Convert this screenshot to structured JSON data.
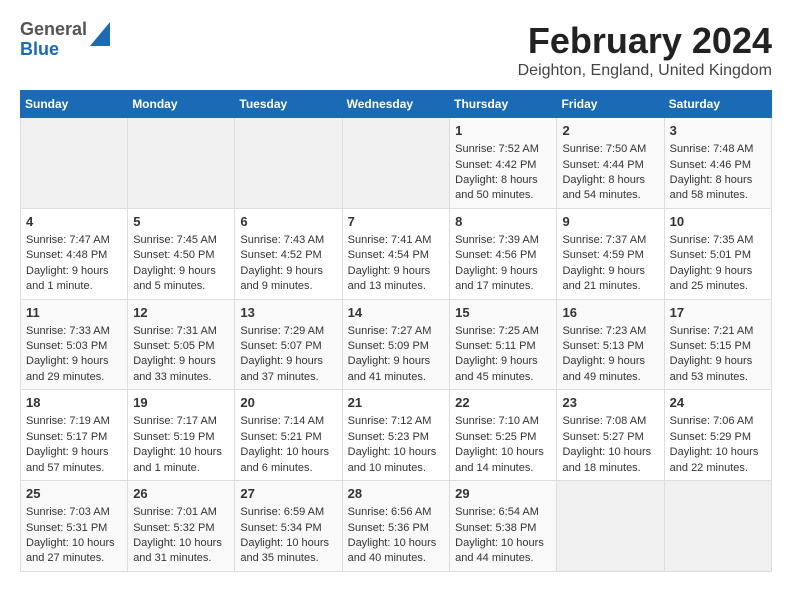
{
  "header": {
    "logo_general": "General",
    "logo_blue": "Blue",
    "title": "February 2024",
    "subtitle": "Deighton, England, United Kingdom"
  },
  "days_of_week": [
    "Sunday",
    "Monday",
    "Tuesday",
    "Wednesday",
    "Thursday",
    "Friday",
    "Saturday"
  ],
  "weeks": [
    [
      {
        "day": "",
        "content": ""
      },
      {
        "day": "",
        "content": ""
      },
      {
        "day": "",
        "content": ""
      },
      {
        "day": "",
        "content": ""
      },
      {
        "day": "1",
        "content": "Sunrise: 7:52 AM\nSunset: 4:42 PM\nDaylight: 8 hours\nand 50 minutes."
      },
      {
        "day": "2",
        "content": "Sunrise: 7:50 AM\nSunset: 4:44 PM\nDaylight: 8 hours\nand 54 minutes."
      },
      {
        "day": "3",
        "content": "Sunrise: 7:48 AM\nSunset: 4:46 PM\nDaylight: 8 hours\nand 58 minutes."
      }
    ],
    [
      {
        "day": "4",
        "content": "Sunrise: 7:47 AM\nSunset: 4:48 PM\nDaylight: 9 hours\nand 1 minute."
      },
      {
        "day": "5",
        "content": "Sunrise: 7:45 AM\nSunset: 4:50 PM\nDaylight: 9 hours\nand 5 minutes."
      },
      {
        "day": "6",
        "content": "Sunrise: 7:43 AM\nSunset: 4:52 PM\nDaylight: 9 hours\nand 9 minutes."
      },
      {
        "day": "7",
        "content": "Sunrise: 7:41 AM\nSunset: 4:54 PM\nDaylight: 9 hours\nand 13 minutes."
      },
      {
        "day": "8",
        "content": "Sunrise: 7:39 AM\nSunset: 4:56 PM\nDaylight: 9 hours\nand 17 minutes."
      },
      {
        "day": "9",
        "content": "Sunrise: 7:37 AM\nSunset: 4:59 PM\nDaylight: 9 hours\nand 21 minutes."
      },
      {
        "day": "10",
        "content": "Sunrise: 7:35 AM\nSunset: 5:01 PM\nDaylight: 9 hours\nand 25 minutes."
      }
    ],
    [
      {
        "day": "11",
        "content": "Sunrise: 7:33 AM\nSunset: 5:03 PM\nDaylight: 9 hours\nand 29 minutes."
      },
      {
        "day": "12",
        "content": "Sunrise: 7:31 AM\nSunset: 5:05 PM\nDaylight: 9 hours\nand 33 minutes."
      },
      {
        "day": "13",
        "content": "Sunrise: 7:29 AM\nSunset: 5:07 PM\nDaylight: 9 hours\nand 37 minutes."
      },
      {
        "day": "14",
        "content": "Sunrise: 7:27 AM\nSunset: 5:09 PM\nDaylight: 9 hours\nand 41 minutes."
      },
      {
        "day": "15",
        "content": "Sunrise: 7:25 AM\nSunset: 5:11 PM\nDaylight: 9 hours\nand 45 minutes."
      },
      {
        "day": "16",
        "content": "Sunrise: 7:23 AM\nSunset: 5:13 PM\nDaylight: 9 hours\nand 49 minutes."
      },
      {
        "day": "17",
        "content": "Sunrise: 7:21 AM\nSunset: 5:15 PM\nDaylight: 9 hours\nand 53 minutes."
      }
    ],
    [
      {
        "day": "18",
        "content": "Sunrise: 7:19 AM\nSunset: 5:17 PM\nDaylight: 9 hours\nand 57 minutes."
      },
      {
        "day": "19",
        "content": "Sunrise: 7:17 AM\nSunset: 5:19 PM\nDaylight: 10 hours\nand 1 minute."
      },
      {
        "day": "20",
        "content": "Sunrise: 7:14 AM\nSunset: 5:21 PM\nDaylight: 10 hours\nand 6 minutes."
      },
      {
        "day": "21",
        "content": "Sunrise: 7:12 AM\nSunset: 5:23 PM\nDaylight: 10 hours\nand 10 minutes."
      },
      {
        "day": "22",
        "content": "Sunrise: 7:10 AM\nSunset: 5:25 PM\nDaylight: 10 hours\nand 14 minutes."
      },
      {
        "day": "23",
        "content": "Sunrise: 7:08 AM\nSunset: 5:27 PM\nDaylight: 10 hours\nand 18 minutes."
      },
      {
        "day": "24",
        "content": "Sunrise: 7:06 AM\nSunset: 5:29 PM\nDaylight: 10 hours\nand 22 minutes."
      }
    ],
    [
      {
        "day": "25",
        "content": "Sunrise: 7:03 AM\nSunset: 5:31 PM\nDaylight: 10 hours\nand 27 minutes."
      },
      {
        "day": "26",
        "content": "Sunrise: 7:01 AM\nSunset: 5:32 PM\nDaylight: 10 hours\nand 31 minutes."
      },
      {
        "day": "27",
        "content": "Sunrise: 6:59 AM\nSunset: 5:34 PM\nDaylight: 10 hours\nand 35 minutes."
      },
      {
        "day": "28",
        "content": "Sunrise: 6:56 AM\nSunset: 5:36 PM\nDaylight: 10 hours\nand 40 minutes."
      },
      {
        "day": "29",
        "content": "Sunrise: 6:54 AM\nSunset: 5:38 PM\nDaylight: 10 hours\nand 44 minutes."
      },
      {
        "day": "",
        "content": ""
      },
      {
        "day": "",
        "content": ""
      }
    ]
  ]
}
